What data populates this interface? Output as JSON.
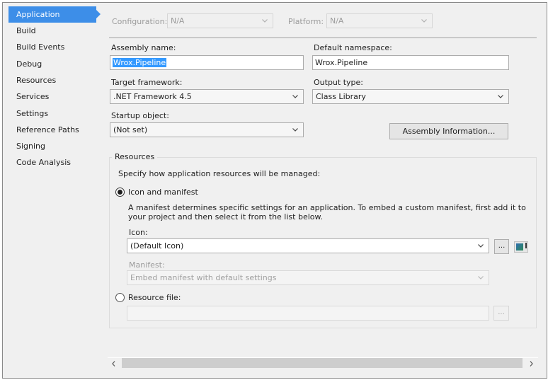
{
  "sidebar": {
    "items": [
      {
        "label": "Application",
        "active": true
      },
      {
        "label": "Build"
      },
      {
        "label": "Build Events"
      },
      {
        "label": "Debug"
      },
      {
        "label": "Resources"
      },
      {
        "label": "Services"
      },
      {
        "label": "Settings"
      },
      {
        "label": "Reference Paths"
      },
      {
        "label": "Signing"
      },
      {
        "label": "Code Analysis"
      }
    ]
  },
  "toolbar": {
    "configuration_label": "Configuration:",
    "configuration_value": "N/A",
    "platform_label": "Platform:",
    "platform_value": "N/A"
  },
  "form": {
    "assembly_name_label": "Assembly name:",
    "assembly_name_value": "Wrox.Pipeline",
    "default_namespace_label": "Default namespace:",
    "default_namespace_value": "Wrox.Pipeline",
    "target_framework_label": "Target framework:",
    "target_framework_value": ".NET Framework 4.5",
    "output_type_label": "Output type:",
    "output_type_value": "Class Library",
    "startup_object_label": "Startup object:",
    "startup_object_value": "(Not set)",
    "assembly_info_button": "Assembly Information..."
  },
  "resources": {
    "group_title": "Resources",
    "description": "Specify how application resources will be managed:",
    "icon_manifest_option": "Icon and manifest",
    "icon_manifest_selected": true,
    "manifest_help_line1": "A manifest determines specific settings for an application. To embed a custom manifest, first add it to",
    "manifest_help_line2": "your project and then select it from the list below.",
    "icon_label": "Icon:",
    "icon_value": "(Default Icon)",
    "browse_button": "...",
    "manifest_label": "Manifest:",
    "manifest_value": "Embed manifest with default settings",
    "resource_file_option": "Resource file:",
    "resource_file_selected": false,
    "resource_file_value": "",
    "resource_browse_button": "..."
  }
}
